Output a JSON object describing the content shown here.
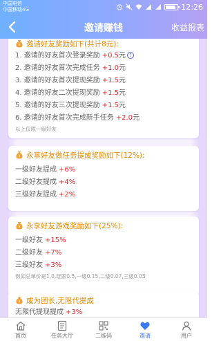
{
  "statusbar": {
    "carrier1": "中国电信",
    "carrier2": "中国移动4G",
    "time": "12:26"
  },
  "header": {
    "title": "邀请赚钱",
    "report": "收益报表"
  },
  "section1": {
    "title": "邀请好友奖励如下(共计8元):",
    "rows": [
      {
        "label": "1. 邀请的好友首次登录奖励",
        "amount": "+0.5",
        "unit": "元"
      },
      {
        "label": "2. 邀请的好友首次完成任务",
        "amount": "+1.0",
        "unit": "元"
      },
      {
        "label": "3. 邀请的好友首次提现奖励",
        "amount": "+1.5",
        "unit": "元"
      },
      {
        "label": "4. 邀请的好友二次提现奖励",
        "amount": "+1.5",
        "unit": "元"
      },
      {
        "label": "5. 邀请的好友三次提现奖励",
        "amount": "+1.5",
        "unit": "元"
      },
      {
        "label": "6. 邀请的好友首次完成新手任务",
        "amount": "+2.0",
        "unit": "元"
      }
    ],
    "note": "以上仅限一级好友"
  },
  "section2": {
    "title": "永享好友做任务提成奖励如下(12%):",
    "rows": [
      {
        "label": "一级好友提成",
        "amount": "+6%"
      },
      {
        "label": "二级好友提成",
        "amount": "+4%"
      },
      {
        "label": "三级好友提成",
        "amount": "+2%"
      }
    ]
  },
  "section3": {
    "title": "永享好友游戏奖励如下(25%):",
    "rows": [
      {
        "label": "一级好友",
        "amount": "+15%"
      },
      {
        "label": "二级好友",
        "amount": "+7%"
      },
      {
        "label": "三级好友",
        "amount": "+3%"
      }
    ],
    "note": "例如总单价是1.0,玩家0.5,一级0.15,二级0.07,三级0.03"
  },
  "section4": {
    "title": "成为团长,无限代提成",
    "rows": [
      {
        "label": "无限代提现提成",
        "amount": "+3%"
      }
    ]
  },
  "tabs": [
    {
      "label": "首页",
      "icon": "home-icon"
    },
    {
      "label": "任务大厅",
      "icon": "task-list-icon"
    },
    {
      "label": "二维码",
      "icon": "qrcode-icon"
    },
    {
      "label": "邀请",
      "icon": "heart-icon"
    },
    {
      "label": "用户",
      "icon": "user-icon"
    }
  ],
  "colors": {
    "accent": "#e58a00",
    "amount": "#e02a2a",
    "active_tab": "#3a7cf0"
  }
}
